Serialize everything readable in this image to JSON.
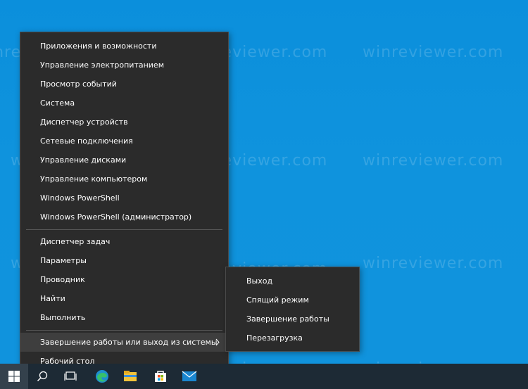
{
  "watermark": "winreviewer.com",
  "menu": {
    "items": [
      "Приложения и возможности",
      "Управление электропитанием",
      "Просмотр событий",
      "Система",
      "Диспетчер устройств",
      "Сетевые подключения",
      "Управление дисками",
      "Управление компьютером",
      "Windows PowerShell",
      "Windows PowerShell (администратор)",
      "Диспетчер задач",
      "Параметры",
      "Проводник",
      "Найти",
      "Выполнить",
      "Завершение работы или выход из системы",
      "Рабочий стол"
    ]
  },
  "submenu": {
    "items": [
      "Выход",
      "Спящий режим",
      "Завершение работы",
      "Перезагрузка"
    ]
  },
  "taskbar": {
    "icons": [
      "windows-start-icon",
      "search-icon",
      "task-view-icon",
      "edge-icon",
      "file-explorer-icon",
      "store-icon",
      "mail-icon"
    ]
  },
  "colors": {
    "desktop": "#0f93dd",
    "menu_bg": "#2b2b2b",
    "menu_highlight": "#3e3e3e",
    "taskbar": "#1d2a35"
  }
}
